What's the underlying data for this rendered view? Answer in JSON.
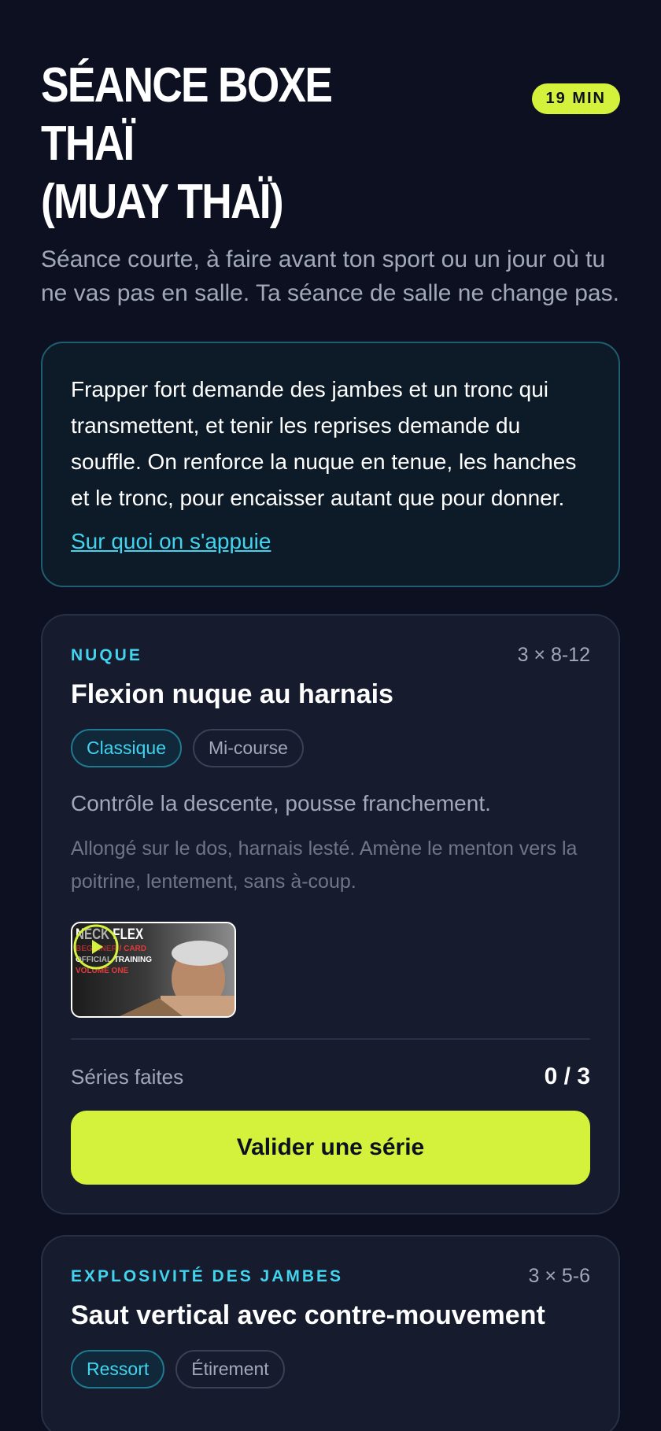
{
  "header": {
    "title": "SÉANCE BOXE THAÏ\n(MUAY THAÏ)",
    "duration": "19 MIN",
    "subtitle": "Séance courte, à faire avant ton sport ou un jour où tu ne vas pas en salle. Ta séance de salle ne change pas."
  },
  "intro": {
    "text": "Frapper fort demande des jambes et un tronc qui transmettent, et tenir les reprises demande du souffle. On renforce la nuque en tenue, les hanches et le tronc, pour encaisser autant que pour donner.",
    "link": "Sur quoi on s'appuie"
  },
  "exercises": [
    {
      "category": "NUQUE",
      "sets": "3 × 8-12",
      "name": "Flexion nuque au harnais",
      "tags": [
        "Classique",
        "Mi-course"
      ],
      "cue": "Contrôle la descente, pousse franchement.",
      "description": "Allongé sur le dos, harnais lesté. Amène le menton vers la poitrine, lentement, sans à-coup.",
      "video": {
        "line1": "NECK FLEX",
        "line2": "BEGINNER / CARD",
        "line3": "OFFICIAL TRAINING",
        "line4": "VOLUME ONE"
      },
      "progress_label": "Séries faites",
      "progress_value": "0 / 3",
      "button_label": "Valider une série"
    },
    {
      "category": "EXPLOSIVITÉ DES JAMBES",
      "sets": "3 × 5-6",
      "name": "Saut vertical avec contre-mouvement",
      "tags": [
        "Ressort",
        "Étirement"
      ]
    }
  ],
  "colors": {
    "background": "#0c1020",
    "accent_lime": "#d4f23c",
    "accent_cyan": "#42d4ee",
    "card": "#161b2d"
  }
}
